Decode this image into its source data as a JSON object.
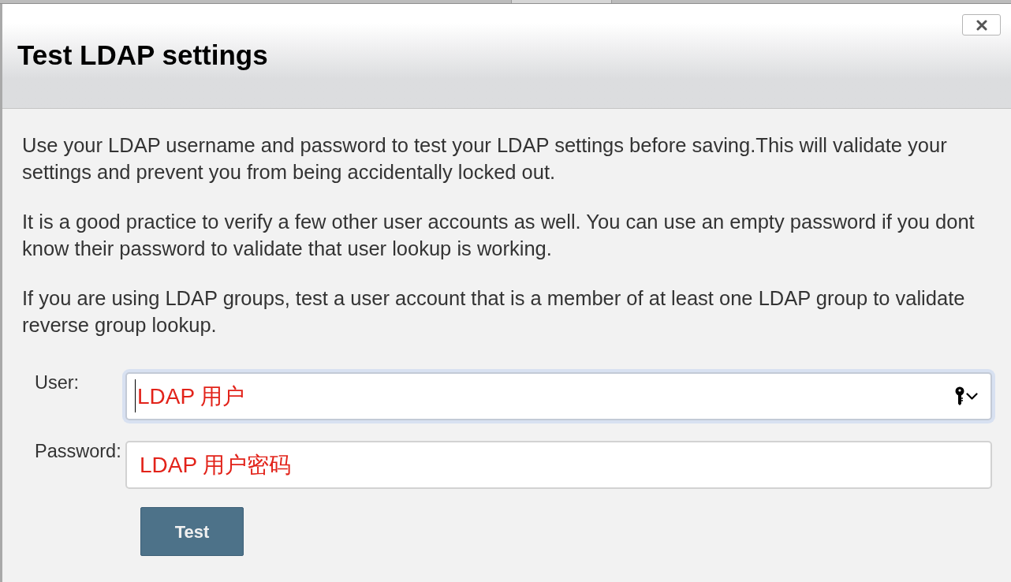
{
  "dialog": {
    "title": "Test LDAP settings"
  },
  "paragraphs": [
    "Use your LDAP username and password to test your LDAP settings before saving.This will validate your settings and prevent you from being accidentally locked out.",
    "It is a good practice to verify a few other user accounts as well. You can use an empty password if you dont know their password to validate that user lookup is working.",
    "If you are using LDAP groups, test a user account that is a member of at least one LDAP group to validate reverse group lookup."
  ],
  "fields": [
    {
      "kind": "user",
      "label": "User:",
      "value": "LDAP 用户",
      "focused": true
    },
    {
      "kind": "password",
      "label": "Password:",
      "value": "LDAP 用户密码",
      "focused": false
    }
  ],
  "button": {
    "label": "Test"
  }
}
